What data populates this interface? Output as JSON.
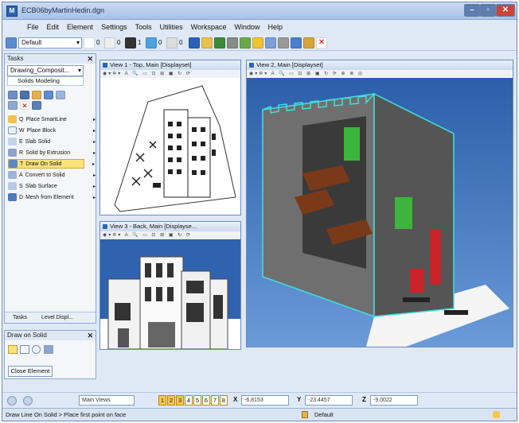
{
  "window": {
    "title": "ECB06byMartinHedin.dgn",
    "app_icon": "M"
  },
  "menu": [
    "File",
    "Edit",
    "Element",
    "Settings",
    "Tools",
    "Utilities",
    "Workspace",
    "Window",
    "Help"
  ],
  "toolbar": {
    "level_value": "Default",
    "values": [
      "0",
      "0",
      "1",
      "0",
      "0"
    ]
  },
  "tasks": {
    "title": "Tasks",
    "dropdown": "Drawing_Composit...",
    "section": "Solids Modeling",
    "items": [
      {
        "key": "Q",
        "label": "Place SmartLine"
      },
      {
        "key": "W",
        "label": "Place Block"
      },
      {
        "key": "E",
        "label": "Slab Solid"
      },
      {
        "key": "R",
        "label": "Solid by Extrusion"
      },
      {
        "key": "T",
        "label": "Draw On Solid"
      },
      {
        "key": "A",
        "label": "Convert to Solid"
      },
      {
        "key": "S",
        "label": "Slab Surface"
      },
      {
        "key": "D",
        "label": "Mesh from Element"
      }
    ],
    "tabs": [
      "Tasks",
      "Level Displ..."
    ]
  },
  "draw_on_solid": {
    "title": "Draw on Solid",
    "close_label": "Close Element"
  },
  "views": {
    "view1": "View 1 - Top, Main [Displayset]",
    "view2": "View 2, Main [Displayset]",
    "view3": "View 3 - Back, Main [Displayse..."
  },
  "bottom": {
    "views_combo": "Main Views",
    "view_buttons": [
      "1",
      "2",
      "3",
      "4",
      "5",
      "6",
      "7",
      "8"
    ],
    "x_label": "X",
    "x_value": "-6.8153",
    "y_label": "Y",
    "y_value": "-23.4457",
    "z_label": "Z",
    "z_value": "-9.0022"
  },
  "status": {
    "prompt": "Draw Line On Solid > Place first point on face",
    "level": "Default"
  },
  "colors": {
    "accent": "#2a62b8",
    "viewport_bg": "#2a5ea8",
    "highlight": "#fbe27a"
  }
}
